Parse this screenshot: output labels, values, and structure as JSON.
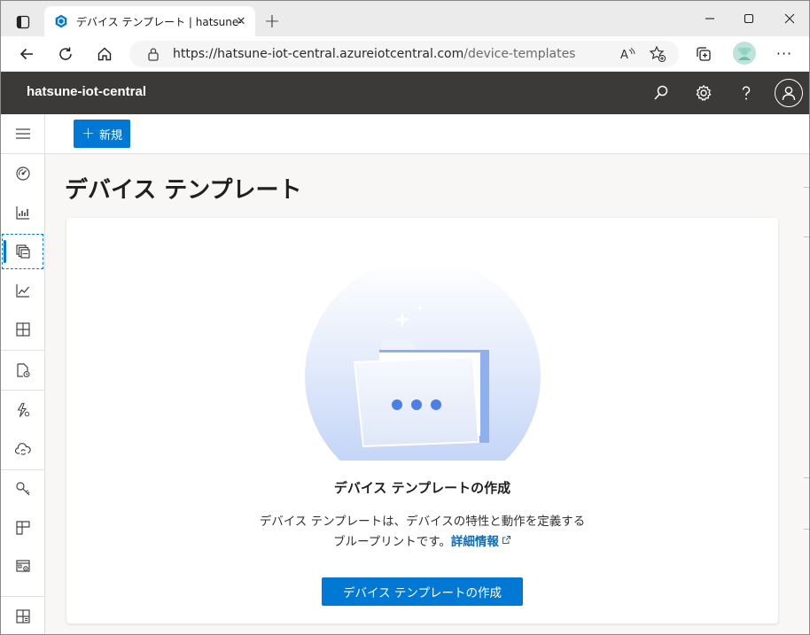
{
  "browser": {
    "tab_title": "デバイス テンプレート | hatsune-iot-c",
    "url_host": "https://hatsune-iot-central.azureiotcentral.com",
    "url_path": "/device-templates",
    "reader_icon_label": "Á",
    "close_glyph": "✕",
    "new_tab_glyph": "+",
    "more_glyph": "···"
  },
  "app": {
    "name": "hatsune-iot-central"
  },
  "command_bar": {
    "new_label": "新規"
  },
  "page": {
    "title": "デバイス テンプレート"
  },
  "empty_state": {
    "heading": "デバイス テンプレートの作成",
    "description_line1": "デバイス テンプレートは、デバイスの特性と動作を定義する",
    "description_line2": "ブループリントです。",
    "learn_more": "詳細情報",
    "create_button": "デバイス テンプレートの作成"
  },
  "colors": {
    "accent": "#0078d4",
    "header_bg": "#3b3a39",
    "link": "#0f6cbd"
  },
  "rail_icons": [
    "menu-icon",
    "dashboard-icon",
    "devices-icon",
    "device-templates-icon",
    "analytics-icon",
    "device-groups-icon",
    "jobs-icon",
    "rules-icon",
    "data-export-icon",
    "permissions-icon",
    "customization-icon",
    "application-settings-icon",
    "iot-central-home-icon"
  ]
}
